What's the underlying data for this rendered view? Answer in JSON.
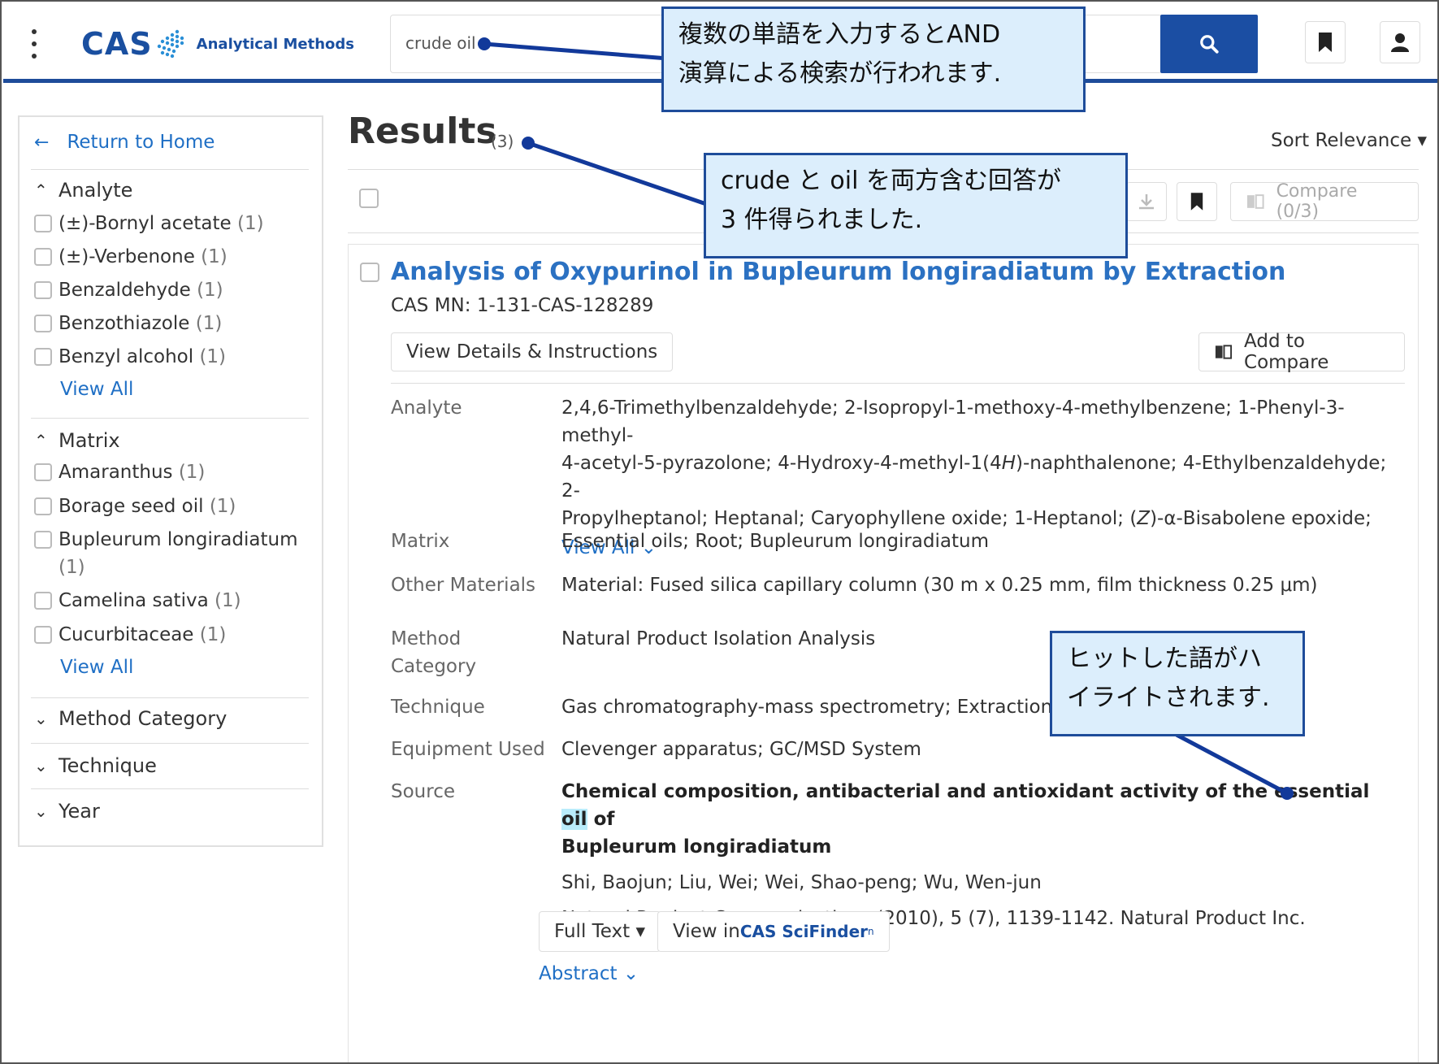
{
  "header": {
    "logo_text": "CAS",
    "logo_subtitle": "Analytical Methods",
    "search_value": "crude oil"
  },
  "sidebar": {
    "return_label": "Return to Home",
    "facets": [
      {
        "title": "Analyte",
        "expanded": true,
        "items": [
          {
            "label": "(±)-Bornyl acetate",
            "count": "(1)"
          },
          {
            "label": "(±)-Verbenone",
            "count": "(1)"
          },
          {
            "label": "Benzaldehyde",
            "count": "(1)"
          },
          {
            "label": "Benzothiazole",
            "count": "(1)"
          },
          {
            "label": "Benzyl alcohol",
            "count": "(1)"
          }
        ],
        "view_all": "View All"
      },
      {
        "title": "Matrix",
        "expanded": true,
        "items": [
          {
            "label": "Amaranthus",
            "count": "(1)"
          },
          {
            "label": "Borage seed oil",
            "count": "(1)"
          },
          {
            "label": "Bupleurum longiradiatum",
            "count": "(1)"
          },
          {
            "label": "Camelina sativa",
            "count": "(1)"
          },
          {
            "label": "Cucurbitaceae",
            "count": "(1)"
          }
        ],
        "view_all": "View All"
      },
      {
        "title": "Method Category",
        "expanded": false
      },
      {
        "title": "Technique",
        "expanded": false
      },
      {
        "title": "Year",
        "expanded": false
      }
    ]
  },
  "results": {
    "title": "Results",
    "count": "(3)",
    "sort_label": "Sort Relevance",
    "compare_label": "Compare (0/3)"
  },
  "card": {
    "title": "Analysis of Oxypurinol in Bupleurum longiradiatum by Extraction",
    "cas_mn": "CAS MN: 1-131-CAS-128289",
    "view_details": "View Details & Instructions",
    "add_compare": "Add to Compare",
    "fields": {
      "analyte_label": "Analyte",
      "analyte_line1": "2,4,6-Trimethylbenzaldehyde; 2-Isopropyl-1-methoxy-4-methylbenzene; 1-Phenyl-3-methyl-",
      "analyte_line2a": "4-acetyl-5-pyrazolone; 4-Hydroxy-4-methyl-1(4",
      "analyte_line2_italic": "H",
      "analyte_line2b": ")-naphthalenone; 4-Ethylbenzaldehyde; 2-",
      "analyte_line3a": "Propylheptanol; Heptanal; Caryophyllene oxide; 1-Heptanol; (",
      "analyte_line3_italic": "Z",
      "analyte_line3b": ")-α-Bisabolene epoxide;",
      "analyte_view_all": "View All",
      "matrix_label": "Matrix",
      "matrix_value": "Essential oils; Root; Bupleurum longiradiatum",
      "other_label": "Other Materials",
      "other_value": "Material: Fused silica capillary column (30 m x 0.25 mm, film thickness 0.25 μm)",
      "method_label_1": "Method",
      "method_label_2": "Category",
      "method_value": "Natural Product Isolation Analysis",
      "technique_label": "Technique",
      "technique_value": "Gas chromatography-mass spectrometry; Extraction",
      "equipment_label": "Equipment Used",
      "equipment_value": "Clevenger apparatus; GC/MSD System",
      "source_label": "Source",
      "source_title_pre": "Chemical composition, antibacterial and antioxidant activity of the essential ",
      "source_title_hit": "oil",
      "source_title_post": " of",
      "source_title_line2": "Bupleurum longiradiatum",
      "authors": "Shi, Baojun; Liu, Wei; Wei, Shao-peng; Wu, Wen-jun",
      "journal": "Natural Product Communications (2010), 5 (7), 1139-1142. Natural Product Inc."
    },
    "full_text": "Full Text",
    "view_in": "View in ",
    "scifinder": "CAS SciFinder",
    "scifinder_sup": "n",
    "abstract": "Abstract"
  },
  "callouts": {
    "search_line1": "複数の単語を入力するとAND",
    "search_line2": "演算による検索が行われます.",
    "count_line1": "crude と oil を両方含む回答が",
    "count_line2": "3 件得られました.",
    "hit_line1": "ヒットした語がハ",
    "hit_line2": "イライトされます."
  },
  "colors": {
    "brand": "#1e4c9a",
    "link": "#1f6fc5",
    "highlight": "#b9ecfb",
    "callout_bg": "#dceefc"
  }
}
